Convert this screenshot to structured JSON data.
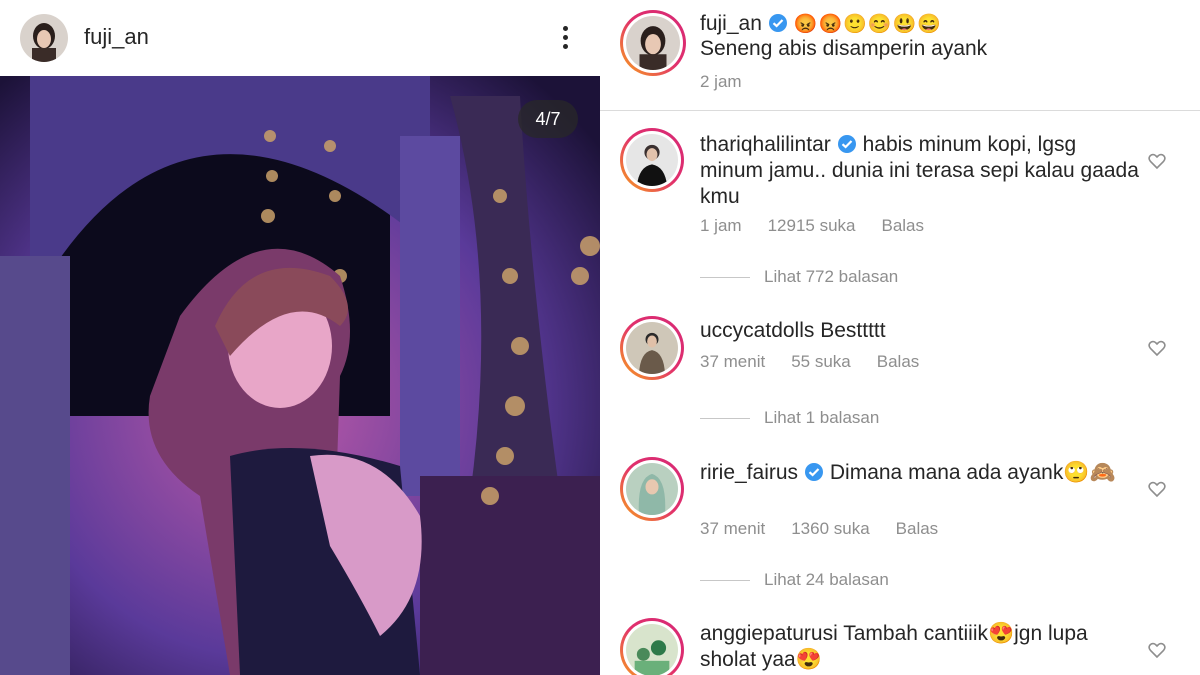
{
  "post": {
    "username": "fuji_an",
    "image_counter": "4/7"
  },
  "caption": {
    "username": "fuji_an",
    "emojis": "😡😡🙂😊😃😄",
    "text": "Seneng abis disamperin ayank",
    "time": "2 jam"
  },
  "comments": [
    {
      "username": "thariqhalilintar",
      "verified": true,
      "text": "habis minum kopi, lgsg minum jamu.. dunia ini terasa sepi kalau gaada kmu",
      "time": "1 jam",
      "likes": "12915 suka",
      "reply_label": "Balas",
      "view_replies": "Lihat 772 balasan"
    },
    {
      "username": "uccycatdolls",
      "verified": false,
      "text": "Besttttt",
      "time": "37 menit",
      "likes": "55 suka",
      "reply_label": "Balas",
      "view_replies": "Lihat 1 balasan"
    },
    {
      "username": "ririe_fairus",
      "verified": true,
      "text": "Dimana mana ada ayank🙄🙈",
      "time": "37 menit",
      "likes": "1360 suka",
      "reply_label": "Balas",
      "view_replies": "Lihat 24 balasan"
    },
    {
      "username": "anggiepaturusi",
      "verified": false,
      "text": "Tambah cantiiik😍jgn lupa sholat yaa😍"
    }
  ],
  "colors": {
    "verified": "#3897f0",
    "meta": "#8e8e8e",
    "text": "#262626"
  }
}
